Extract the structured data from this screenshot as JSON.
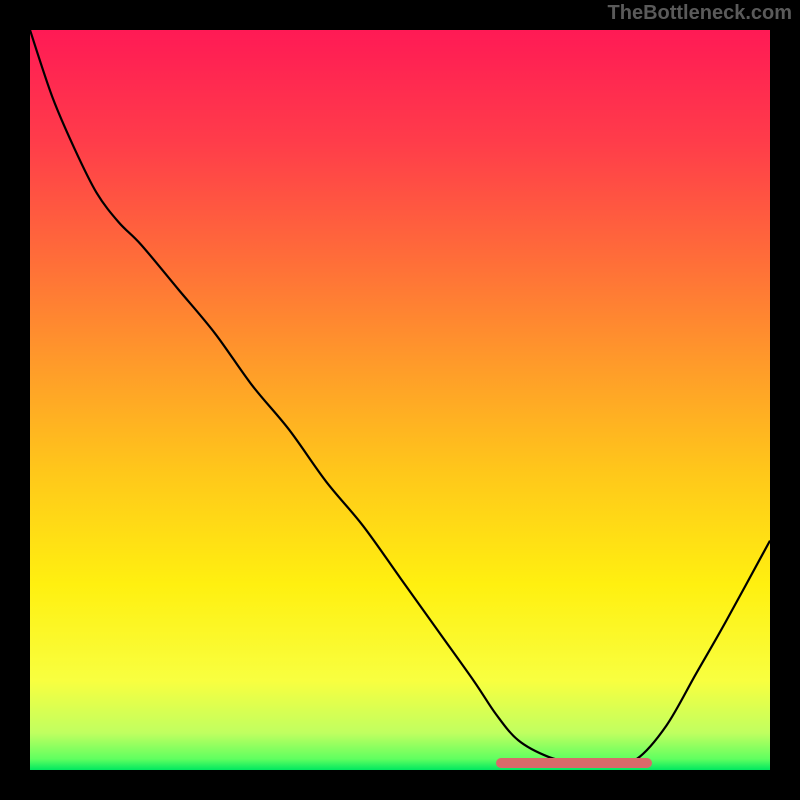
{
  "watermark": "TheBottleneck.com",
  "chart_data": {
    "type": "line",
    "title": "",
    "xlabel": "",
    "ylabel": "",
    "x": [
      0.0,
      0.03,
      0.06,
      0.09,
      0.12,
      0.15,
      0.2,
      0.25,
      0.3,
      0.35,
      0.4,
      0.45,
      0.5,
      0.55,
      0.6,
      0.63,
      0.66,
      0.7,
      0.74,
      0.78,
      0.82,
      0.86,
      0.9,
      0.94,
      1.0
    ],
    "y": [
      1.0,
      0.91,
      0.84,
      0.78,
      0.74,
      0.71,
      0.65,
      0.59,
      0.52,
      0.46,
      0.39,
      0.33,
      0.26,
      0.19,
      0.12,
      0.075,
      0.04,
      0.018,
      0.008,
      0.005,
      0.015,
      0.06,
      0.13,
      0.2,
      0.31
    ],
    "xlim": [
      0,
      1
    ],
    "ylim": [
      0,
      1
    ],
    "optimal_range_x": [
      0.63,
      0.84
    ],
    "background_gradient": {
      "type": "vertical",
      "stops": [
        {
          "pos": 0.0,
          "color": "#ff1a55"
        },
        {
          "pos": 0.15,
          "color": "#ff3c4a"
        },
        {
          "pos": 0.3,
          "color": "#ff6a3a"
        },
        {
          "pos": 0.45,
          "color": "#ff9a2a"
        },
        {
          "pos": 0.6,
          "color": "#ffc81a"
        },
        {
          "pos": 0.75,
          "color": "#fff010"
        },
        {
          "pos": 0.88,
          "color": "#f8ff40"
        },
        {
          "pos": 0.95,
          "color": "#c0ff60"
        },
        {
          "pos": 0.985,
          "color": "#60ff60"
        },
        {
          "pos": 1.0,
          "color": "#00e860"
        }
      ]
    }
  }
}
